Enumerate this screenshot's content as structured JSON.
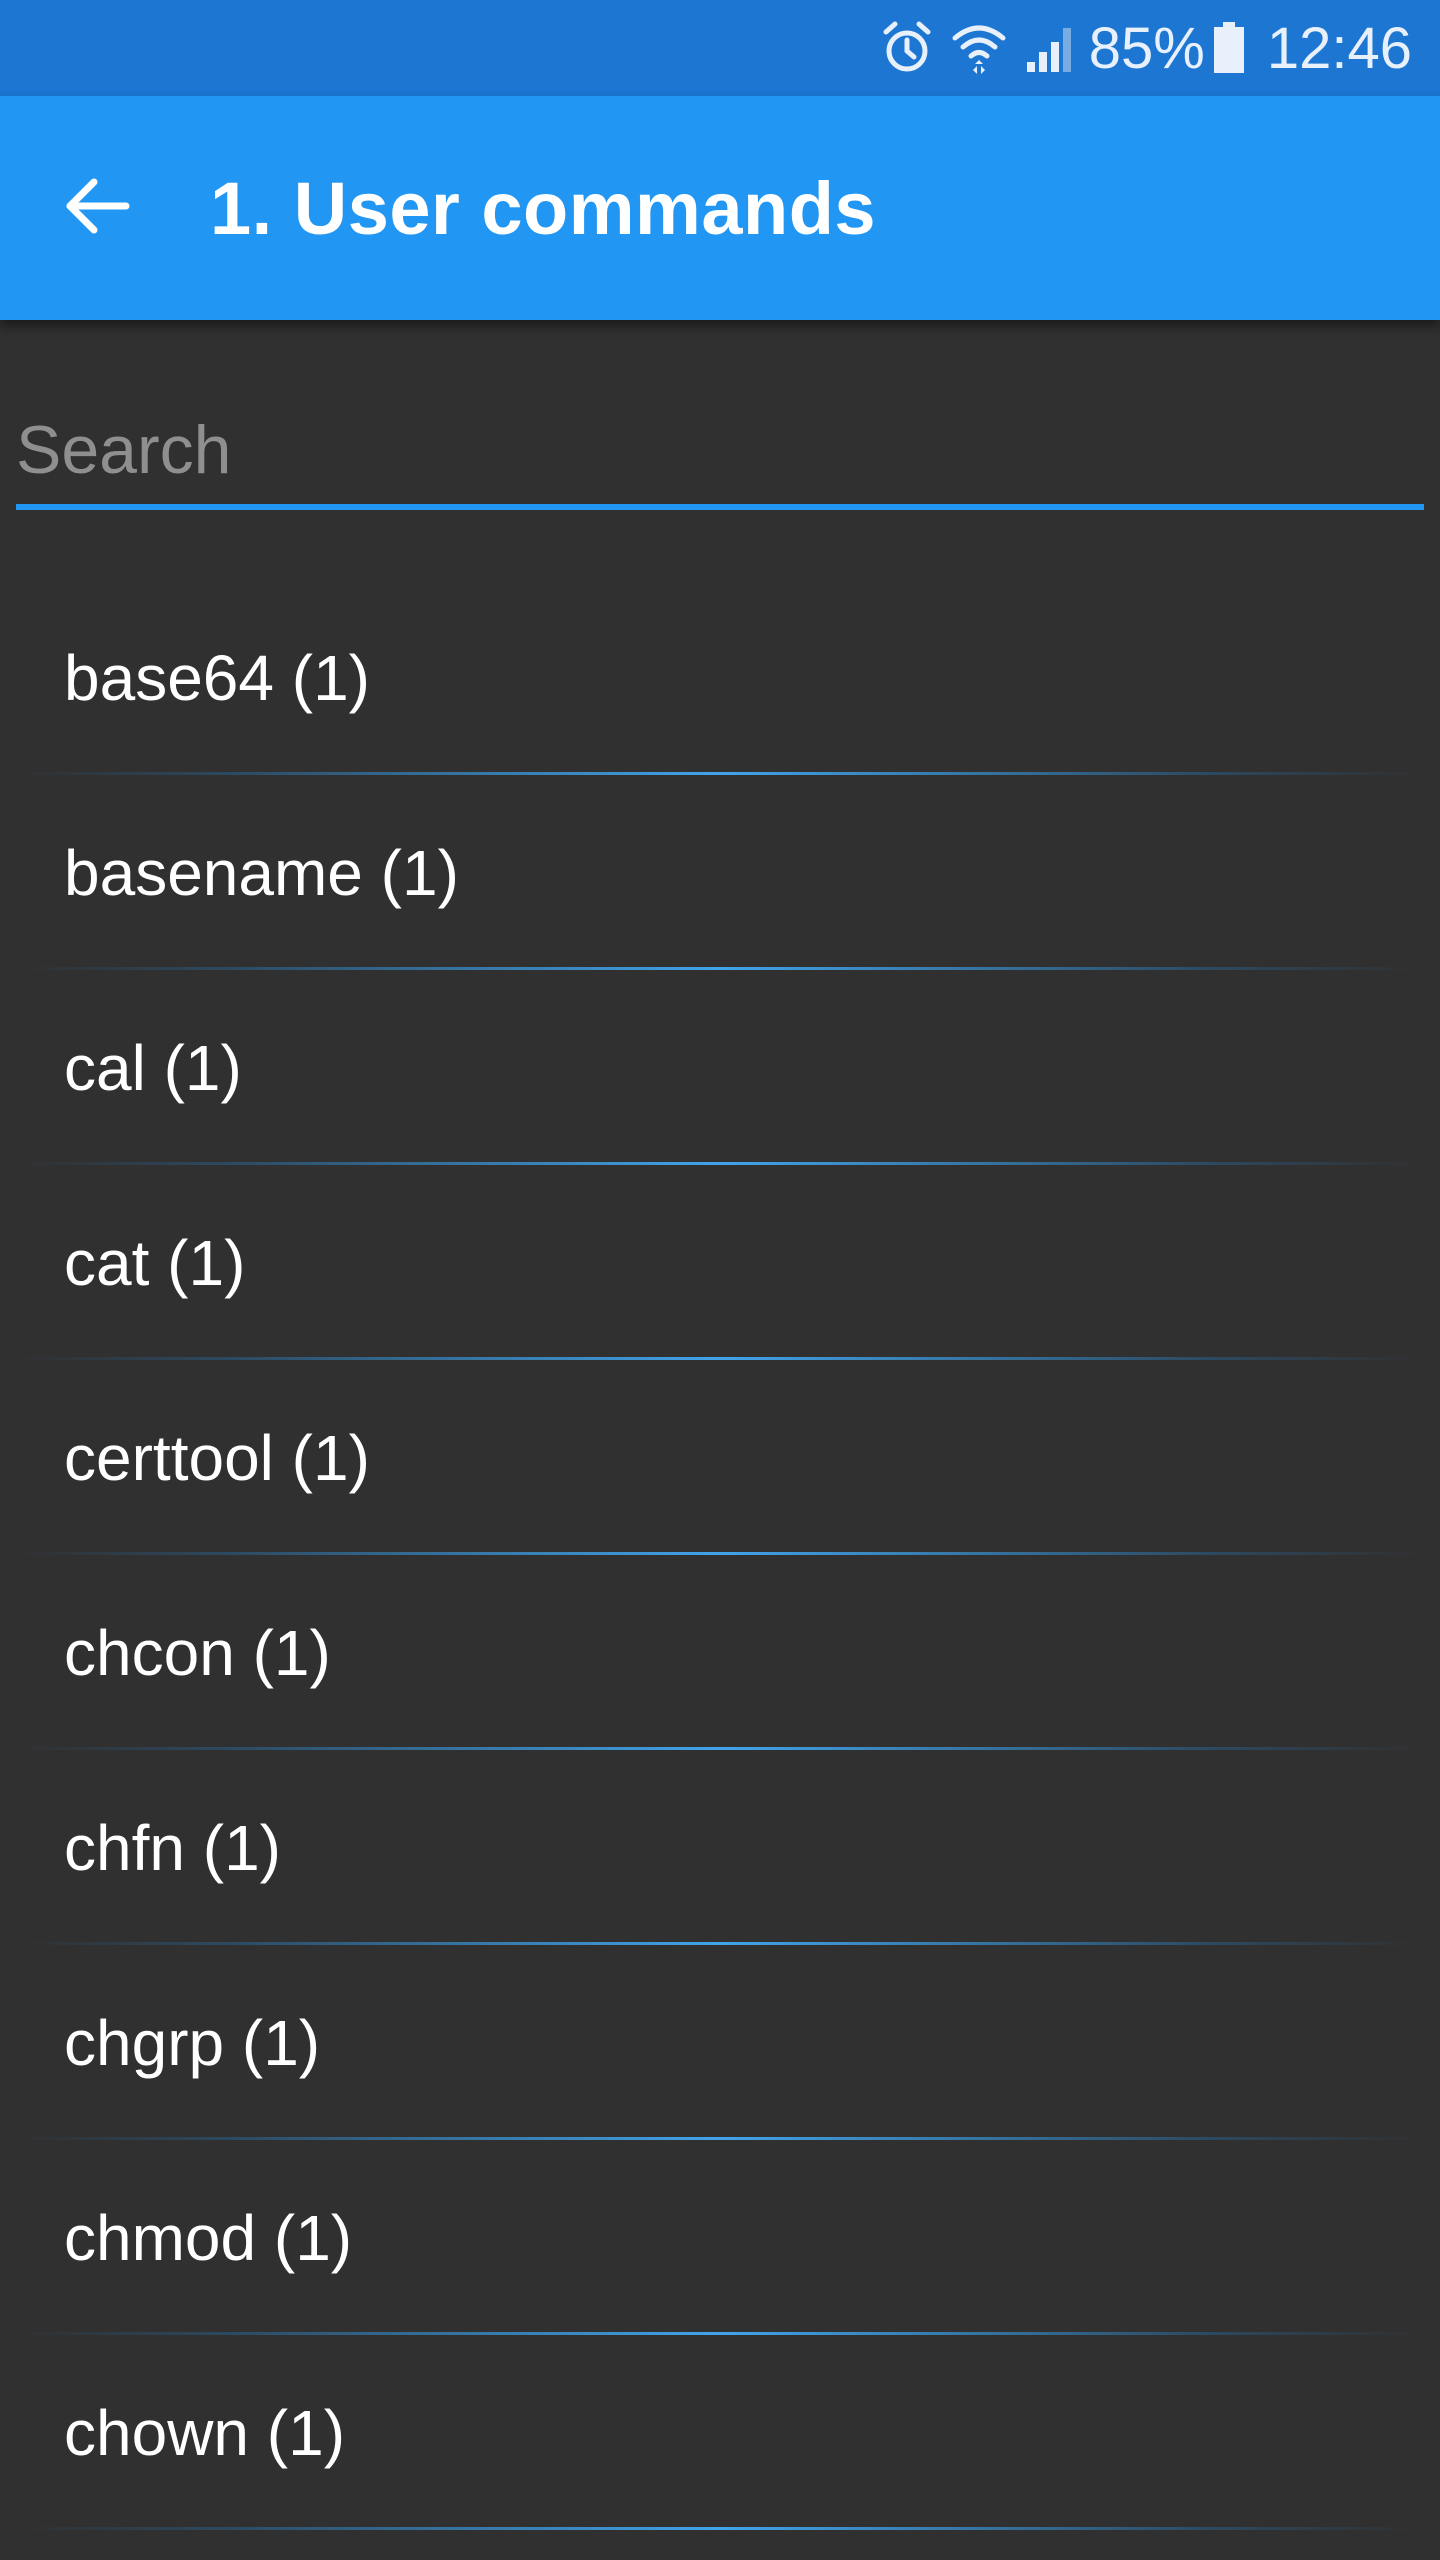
{
  "status_bar": {
    "battery_percent": "85%",
    "time": "12:46",
    "icons": [
      "alarm-icon",
      "wifi-icon",
      "signal-icon",
      "battery-icon"
    ]
  },
  "app_bar": {
    "back_icon": "arrow-left-icon",
    "title": "1. User commands"
  },
  "search": {
    "placeholder": "Search",
    "value": ""
  },
  "colors": {
    "primary": "#2196f3",
    "primary_dark": "#1c76d2",
    "background": "#303030",
    "text": "#ffffff",
    "hint": "#8f8f8f"
  },
  "commands": [
    {
      "label": "base64 (1)"
    },
    {
      "label": "basename (1)"
    },
    {
      "label": "cal (1)"
    },
    {
      "label": "cat (1)"
    },
    {
      "label": "certtool (1)"
    },
    {
      "label": "chcon (1)"
    },
    {
      "label": "chfn (1)"
    },
    {
      "label": "chgrp (1)"
    },
    {
      "label": "chmod (1)"
    },
    {
      "label": "chown (1)"
    }
  ]
}
